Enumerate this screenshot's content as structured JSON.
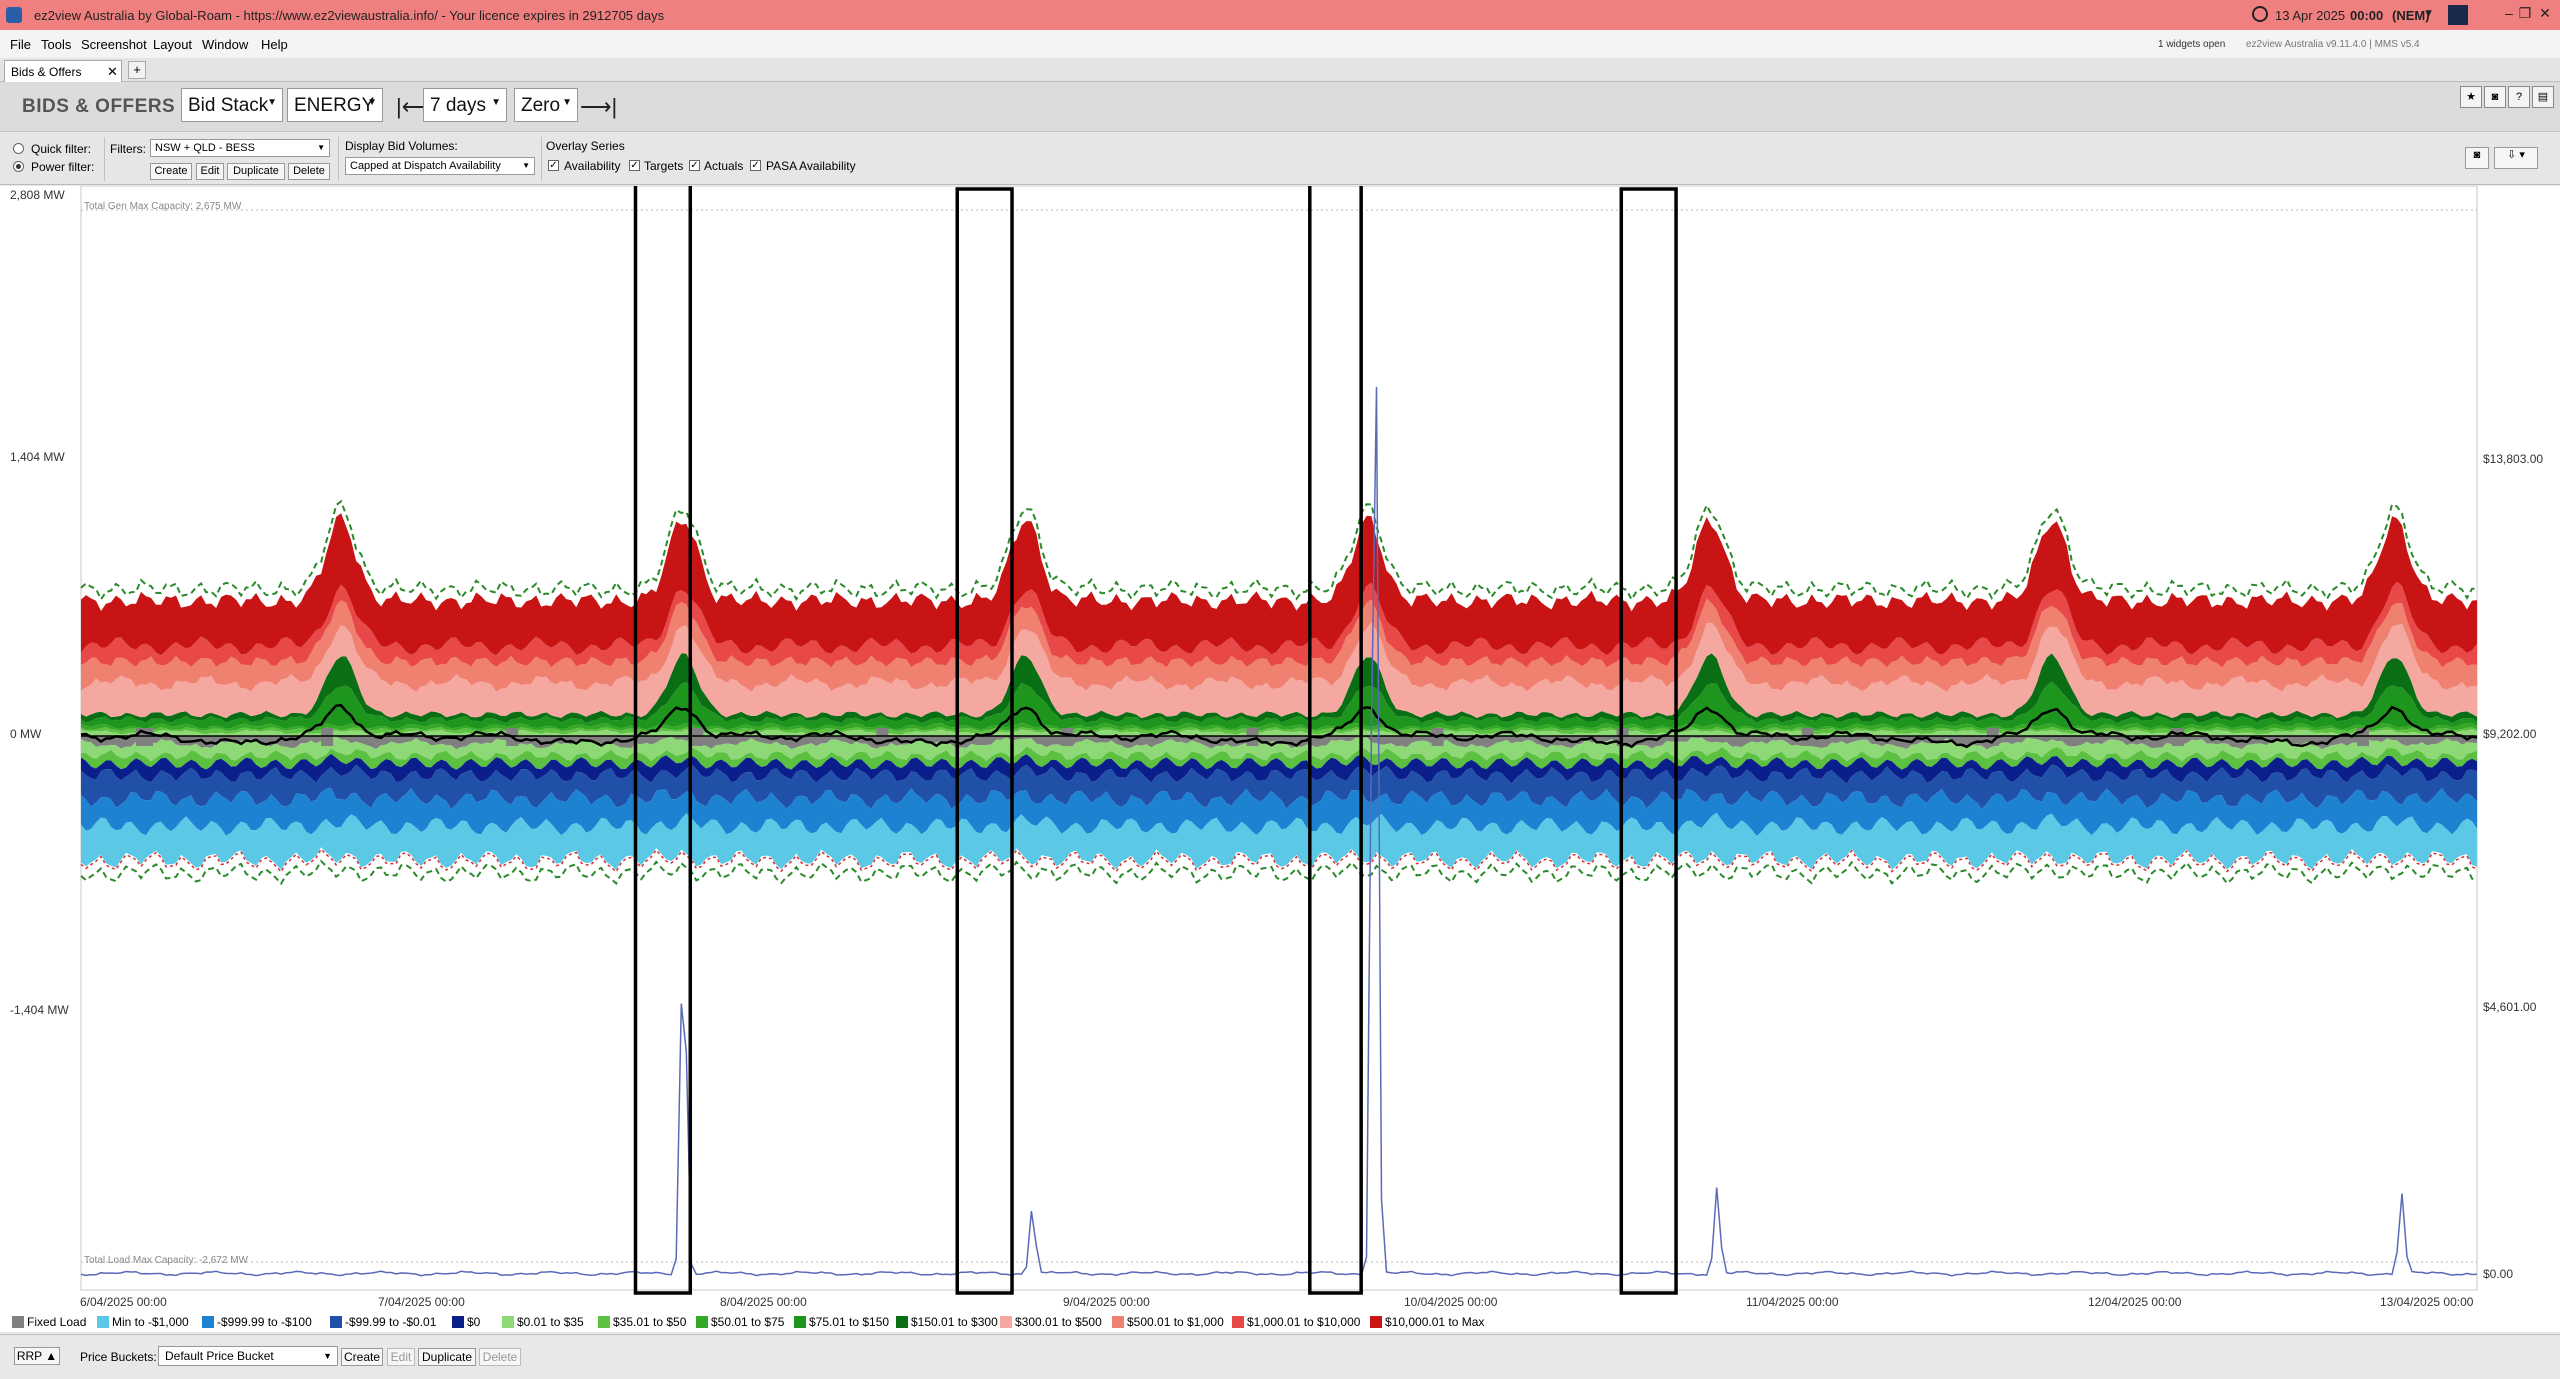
{
  "window": {
    "title": "ez2view Australia by Global-Roam - https://www.ez2viewaustralia.info/ - Your licence expires in 2912705 days",
    "date": "13 Apr 2025",
    "time": "00:00",
    "region": "(NEM)",
    "minimize": "–",
    "restore": "❐",
    "close": "✕"
  },
  "menu": {
    "items": [
      "File",
      "Tools",
      "Screenshot",
      "Layout",
      "Window",
      "Help"
    ],
    "widgets_open": "1 widgets open",
    "version": "ez2view Australia v9.11.4.0 | MMS v5.4"
  },
  "tabs": {
    "active": "Bids & Offers",
    "close": "✕",
    "add": "+"
  },
  "toolbar": {
    "widget_title": "BIDS & OFFERS",
    "view": "Bid Stack",
    "market": "ENERGY",
    "first_icon": "|⟵",
    "period": "7 days",
    "scale": "Zero",
    "last_icon": "⟶|"
  },
  "filters": {
    "quick_filter": "Quick filter:",
    "power_filter": "Power filter:",
    "filters_label": "Filters:",
    "filter_value": "NSW + QLD - BESS",
    "create": "Create",
    "edit": "Edit",
    "duplicate": "Duplicate",
    "delete": "Delete",
    "display_bid_volumes": "Display Bid Volumes:",
    "bid_volume_mode": "Capped at Dispatch Availability",
    "overlay_series": "Overlay Series",
    "availability": "Availability",
    "targets": "Targets",
    "actuals": "Actuals",
    "pasa_availability": "PASA Availability",
    "check": "✓"
  },
  "chart_data": {
    "type": "area",
    "description_of_axes": "stacked bid volumes by price band (MW, left axis) with RRP price line (right axis)",
    "left_axis": {
      "ticks": [
        "2,808 MW",
        "1,404 MW",
        "0 MW",
        "-1,404 MW"
      ],
      "range": [
        -2808,
        2808
      ]
    },
    "right_axis": {
      "ticks": [
        "$13,803.00",
        "$9,202.00",
        "$4,601.00",
        "$0.00"
      ],
      "range": [
        0,
        18404
      ]
    },
    "x_axis": {
      "ticks": [
        "6/04/2025 00:00",
        "7/04/2025 00:00",
        "8/04/2025 00:00",
        "9/04/2025 00:00",
        "10/04/2025 00:00",
        "11/04/2025 00:00",
        "12/04/2025 00:00",
        "13/04/2025 00:00"
      ]
    },
    "annotations": {
      "gen_max": "Total Gen Max Capacity: 2,675 MW",
      "load_max": "Total Load Max Capacity: -2,672 MW"
    },
    "highlight_boxes": [
      "7/04 evening",
      "8/04 evening",
      "9/04 evening",
      "10/04 evening"
    ],
    "price_spikes": [
      {
        "time": "7/04/2025 ~18:00",
        "rrp": 5980
      },
      {
        "time": "8/04/2025 ~18:30",
        "rrp": 1150
      },
      {
        "time": "9/04/2025 ~18:30",
        "rrp": 17600
      },
      {
        "time": "10/04/2025 ~18:30",
        "rrp": 1450
      },
      {
        "time": "12/04/2025 ~18:30",
        "rrp": 1350
      }
    ],
    "series": [
      {
        "name": "Fixed Load",
        "color": "#808080"
      },
      {
        "name": "Min to -$1,000",
        "color": "#5bc8e6"
      },
      {
        "name": "-$999.99 to -$100",
        "color": "#1e82d2"
      },
      {
        "name": "-$99.99 to -$0.01",
        "color": "#2050a8"
      },
      {
        "name": "$0",
        "color": "#0a1e8c"
      },
      {
        "name": "$0.01 to $35",
        "color": "#8fd878"
      },
      {
        "name": "$35.01 to $50",
        "color": "#5cc040"
      },
      {
        "name": "$50.01 to $75",
        "color": "#36a828"
      },
      {
        "name": "$75.01 to $150",
        "color": "#1e961e"
      },
      {
        "name": "$150.01 to $300",
        "color": "#0a6e14"
      },
      {
        "name": "$300.01 to $500",
        "color": "#f4a8a0"
      },
      {
        "name": "$500.01 to $1,000",
        "color": "#f08070"
      },
      {
        "name": "$1,000.01 to $10,000",
        "color": "#e84848"
      },
      {
        "name": "$10,000.01 to Max",
        "color": "#c81414"
      }
    ]
  },
  "bottom": {
    "rrp_button": "RRP",
    "rrp_arrow": "▲",
    "price_buckets_label": "Price Buckets:",
    "price_bucket": "Default Price Bucket",
    "create": "Create",
    "edit": "Edit",
    "duplicate": "Duplicate",
    "delete": "Delete"
  }
}
